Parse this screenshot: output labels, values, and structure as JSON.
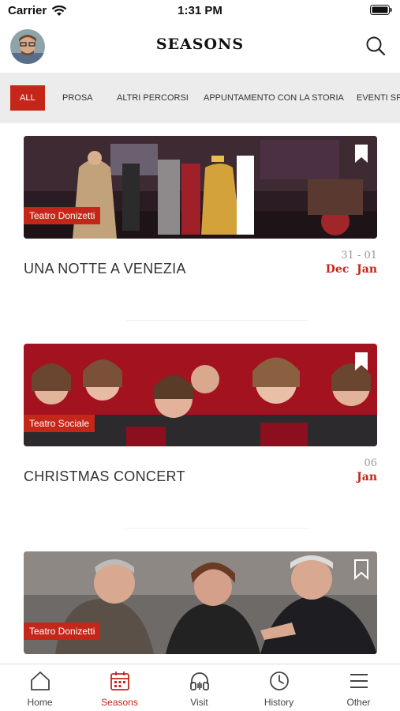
{
  "status_bar": {
    "carrier": "Carrier",
    "time": "1:31 PM"
  },
  "header": {
    "title": "SEASONS"
  },
  "filters": [
    {
      "label": "ALL",
      "active": true
    },
    {
      "label": "PROSA",
      "active": false
    },
    {
      "label": "ALTRI PERCORSI",
      "active": false
    },
    {
      "label": "APPUNTAMENTO CON LA STORIA",
      "active": false
    },
    {
      "label": "EVENTI SPECIALI",
      "active": false
    }
  ],
  "events": [
    {
      "title": "UNA NOTTE A VENEZIA",
      "venue": "Teatro Donizetti",
      "days": "31 - 01",
      "months": "Dec  Jan"
    },
    {
      "title": "CHRISTMAS CONCERT",
      "venue": "Teatro Sociale",
      "days": "06",
      "months": "Jan"
    },
    {
      "title": "",
      "venue": "Teatro Donizetti",
      "days": "",
      "months": ""
    }
  ],
  "tabs": [
    {
      "label": "Home",
      "icon": "home-icon",
      "active": false
    },
    {
      "label": "Seasons",
      "icon": "calendar-icon",
      "active": true
    },
    {
      "label": "Visit",
      "icon": "headphones-icon",
      "active": false
    },
    {
      "label": "History",
      "icon": "clock-icon",
      "active": false
    },
    {
      "label": "Other",
      "icon": "menu-icon",
      "active": false
    }
  ],
  "colors": {
    "accent": "#c4261a",
    "filter_bg": "#ececec"
  }
}
